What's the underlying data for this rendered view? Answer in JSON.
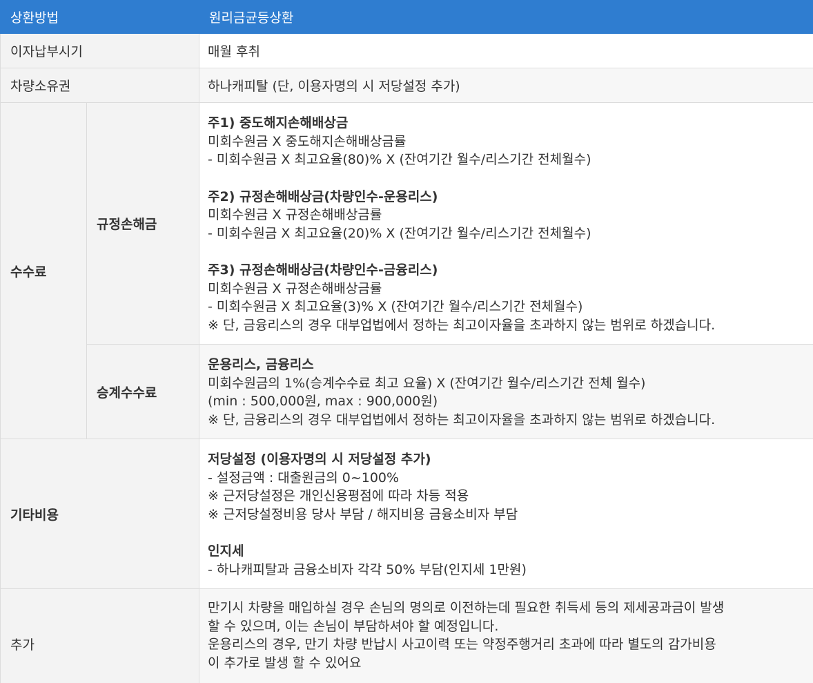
{
  "header": {
    "col1": "상환방법",
    "col2": "원리금균등상환"
  },
  "rows": {
    "interest": {
      "label": "이자납부시기",
      "value": "매월 후취"
    },
    "ownership": {
      "label": "차량소유권",
      "value": "하나캐피탈 (단, 이용자명의 시 저당설정 추가)"
    },
    "fees": {
      "label": "수수료",
      "early": {
        "label": "규정손해금",
        "b1": {
          "title": "주1) 중도해지손해배상금",
          "l1": "미회수원금 X 중도해지손해배상금률",
          "l2": "- 미회수원금 X 최고요율(80)% X (잔여기간 월수/리스기간 전체월수)"
        },
        "b2": {
          "title": "주2) 규정손해배상금(차량인수-운용리스)",
          "l1": "미회수원금 X 규정손해배상금률",
          "l2": "- 미회수원금 X 최고요율(20)% X (잔여기간 월수/리스기간 전체월수)"
        },
        "b3": {
          "title": "주3) 규정손해배상금(차량인수-금융리스)",
          "l1": "미회수원금 X 규정손해배상금률",
          "l2": "- 미회수원금 X 최고요율(3)% X (잔여기간 월수/리스기간 전체월수)",
          "l3": "※ 단, 금융리스의 경우 대부업법에서 정하는 최고이자율을 초과하지 않는 범위로 하겠습니다."
        }
      },
      "transfer": {
        "label": "승계수수료",
        "title": "운용리스, 금융리스",
        "l1": "미회수원금의 1%(승계수수료 최고 요율) X (잔여기간 월수/리스기간 전체 월수)",
        "l2": "(min : 500,000원, max : 900,000원)",
        "l3": "※ 단, 금융리스의 경우 대부업법에서 정하는 최고이자율을 초과하지 않는 범위로 하겠습니다."
      }
    },
    "other": {
      "label": "기타비용",
      "mortgage": {
        "title": "저당설정 (이용자명의 시 저당설정 추가)",
        "l1": "- 설정금액 : 대출원금의 0~100%",
        "l2": "※ 근저당설정은 개인신용평점에 따라 차등 적용",
        "l3": "※ 근저당설정비용 당사 부담 / 해지비용 금융소비자 부담"
      },
      "stamp": {
        "title": "인지세",
        "l1": "- 하나캐피탈과 금융소비자 각각 50% 부담(인지세 1만원)"
      }
    },
    "extra": {
      "label": "추가",
      "l1": "만기시 차량을 매입하실 경우 손님의 명의로 이전하는데 필요한 취득세 등의 제세공과금이 발생",
      "l2": "할 수 있으며, 이는 손님이 부담하셔야 할 예정입니다.",
      "l3": "운용리스의 경우, 만기 차량 반납시 사고이력 또는 약정주행거리 초과에 따라 별도의 감가비용",
      "l4": "이 추가로 발생 할 수 있어요"
    }
  }
}
